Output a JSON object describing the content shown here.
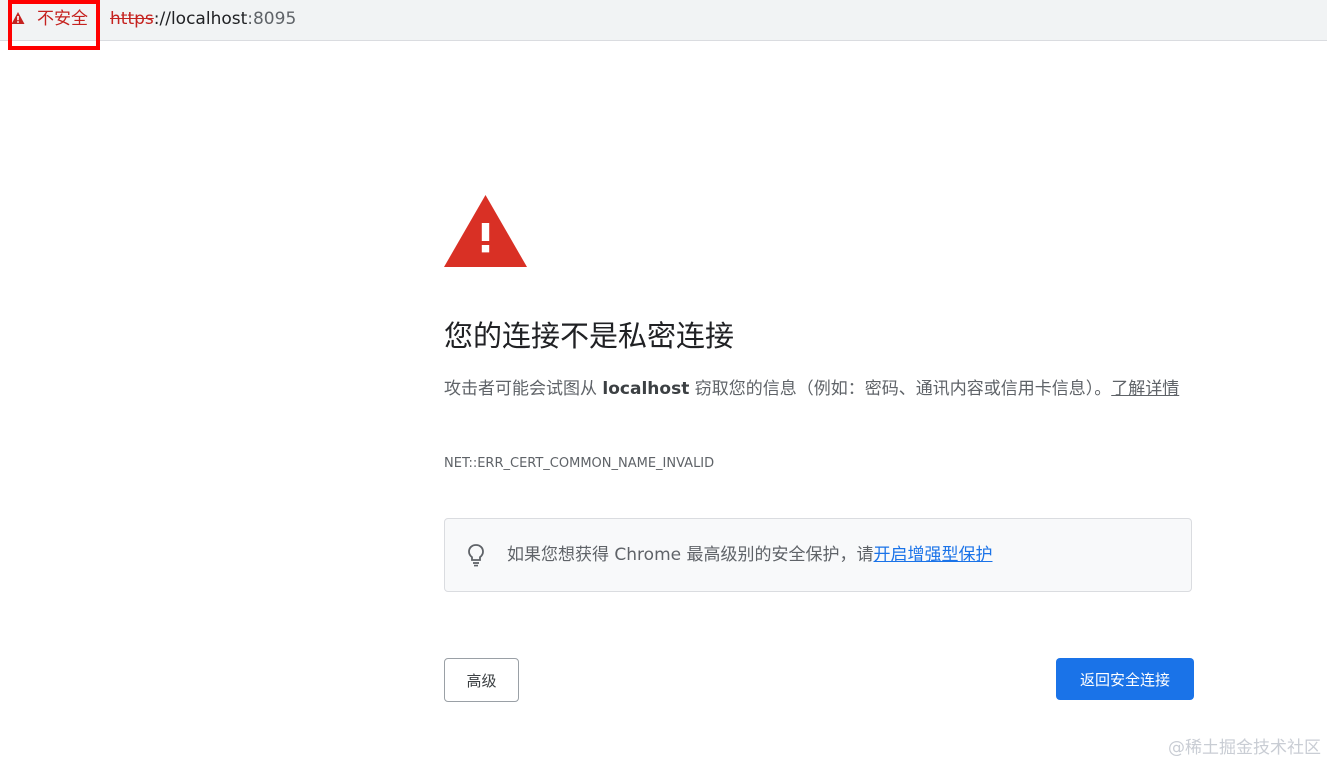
{
  "address_bar": {
    "security_label": "不安全",
    "url_scheme": "https",
    "url_sep": "://",
    "url_host": "localhost",
    "url_port": ":8095"
  },
  "interstitial": {
    "heading": "您的连接不是私密连接",
    "description_before": "攻击者可能会试图从 ",
    "description_host": "localhost",
    "description_after": " 窃取您的信息（例如：密码、通讯内容或信用卡信息）。",
    "learn_more": "了解详情",
    "error_code": "NET::ERR_CERT_COMMON_NAME_INVALID",
    "tip_text": "如果您想获得 Chrome 最高级别的安全保护，请",
    "tip_link": "开启增强型保护",
    "advanced_button": "高级",
    "back_button": "返回安全连接"
  },
  "watermark": "@稀土掘金技术社区",
  "colors": {
    "warning_red": "#d93025",
    "link_blue": "#1a73e8",
    "primary_button": "#1a73e8"
  }
}
